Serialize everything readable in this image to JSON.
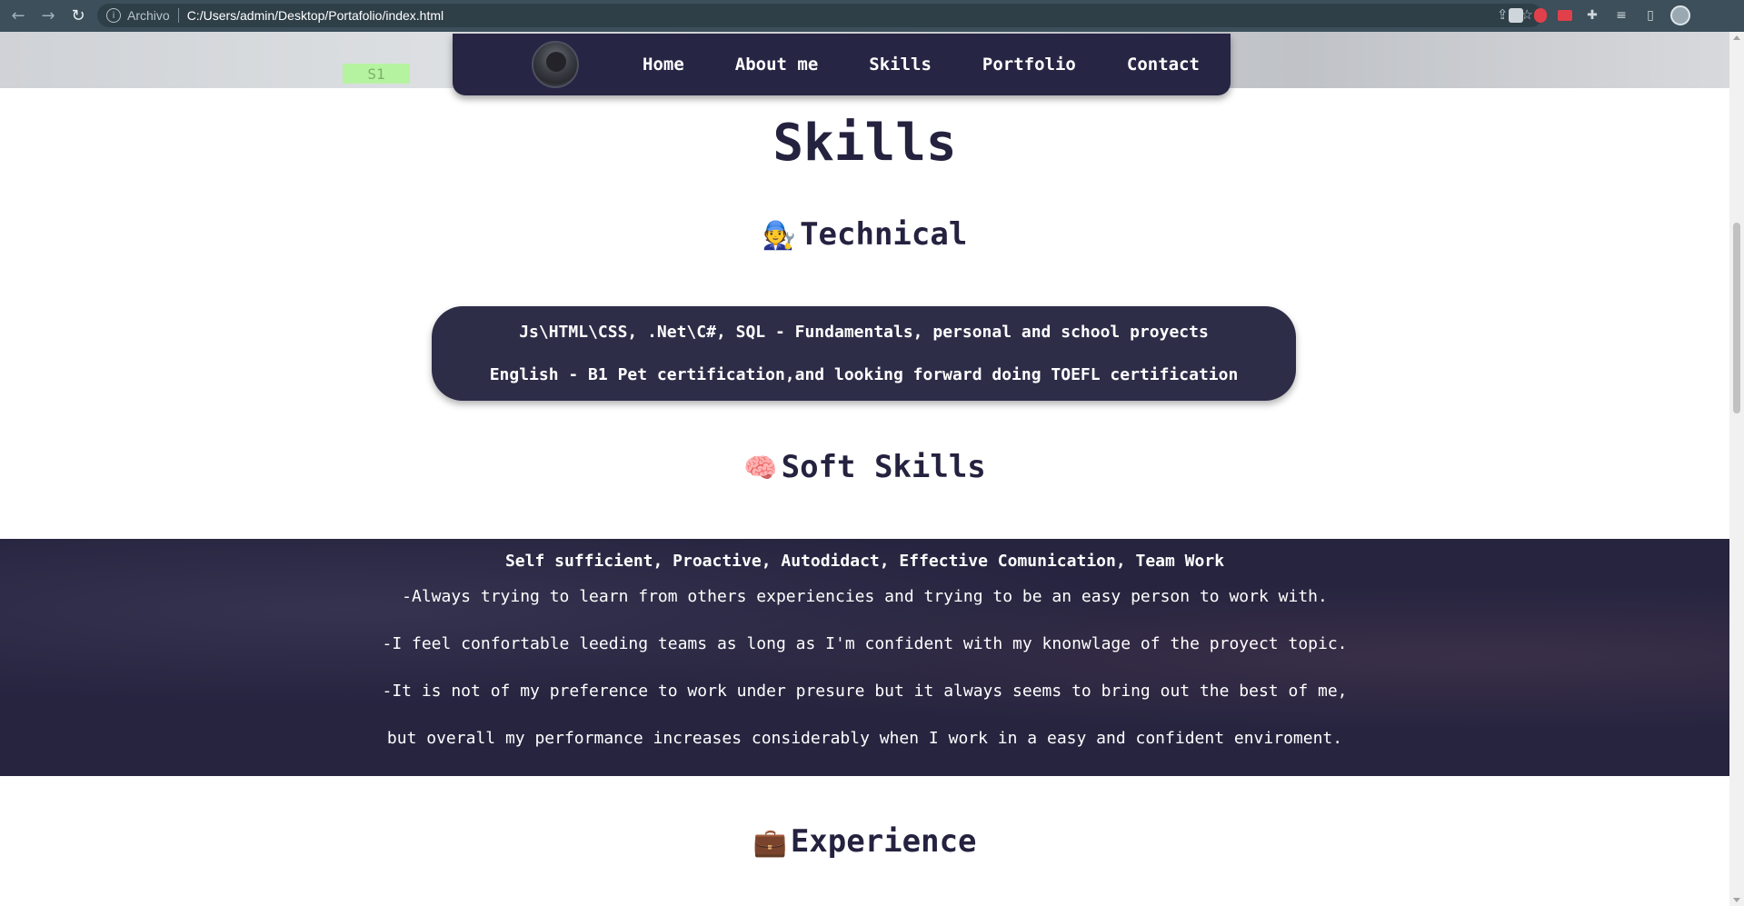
{
  "browser": {
    "back_icon": "arrow-left-icon",
    "forward_icon": "arrow-right-icon",
    "reload_icon": "reload-icon",
    "scheme_label": "Archivo",
    "url": "C:/Users/admin/Desktop/Portafolio/index.html"
  },
  "hero": {
    "tag": "S1"
  },
  "nav": {
    "links": [
      "Home",
      "About me",
      "Skills",
      "Portfolio",
      "Contact"
    ]
  },
  "skills": {
    "title": "Skills",
    "technical": {
      "emoji": "🧑‍🔧",
      "title": "Technical",
      "lines": [
        "Js\\HTML\\CSS, .Net\\C#, SQL - Fundamentals, personal and school proyects",
        "English - B1 Pet certification,and looking forward doing TOEFL certification"
      ]
    },
    "soft": {
      "emoji": "🧠",
      "title": "Soft Skills",
      "summary": "Self sufficient, Proactive, Autodidact, Effective Comunication, Team Work",
      "lines": [
        "-Always trying to learn from others experiencies and trying to be an easy person to work with.",
        "-I feel confortable leeding teams as long as I'm confident with my knonwlage of the proyect topic.",
        "-It is not of my preference to work under presure but it always seems to bring out the best of me,",
        "but overall my performance increases considerably when I work in a easy and confident enviroment."
      ]
    },
    "experience": {
      "emoji": "💼",
      "title": "Experience"
    }
  }
}
